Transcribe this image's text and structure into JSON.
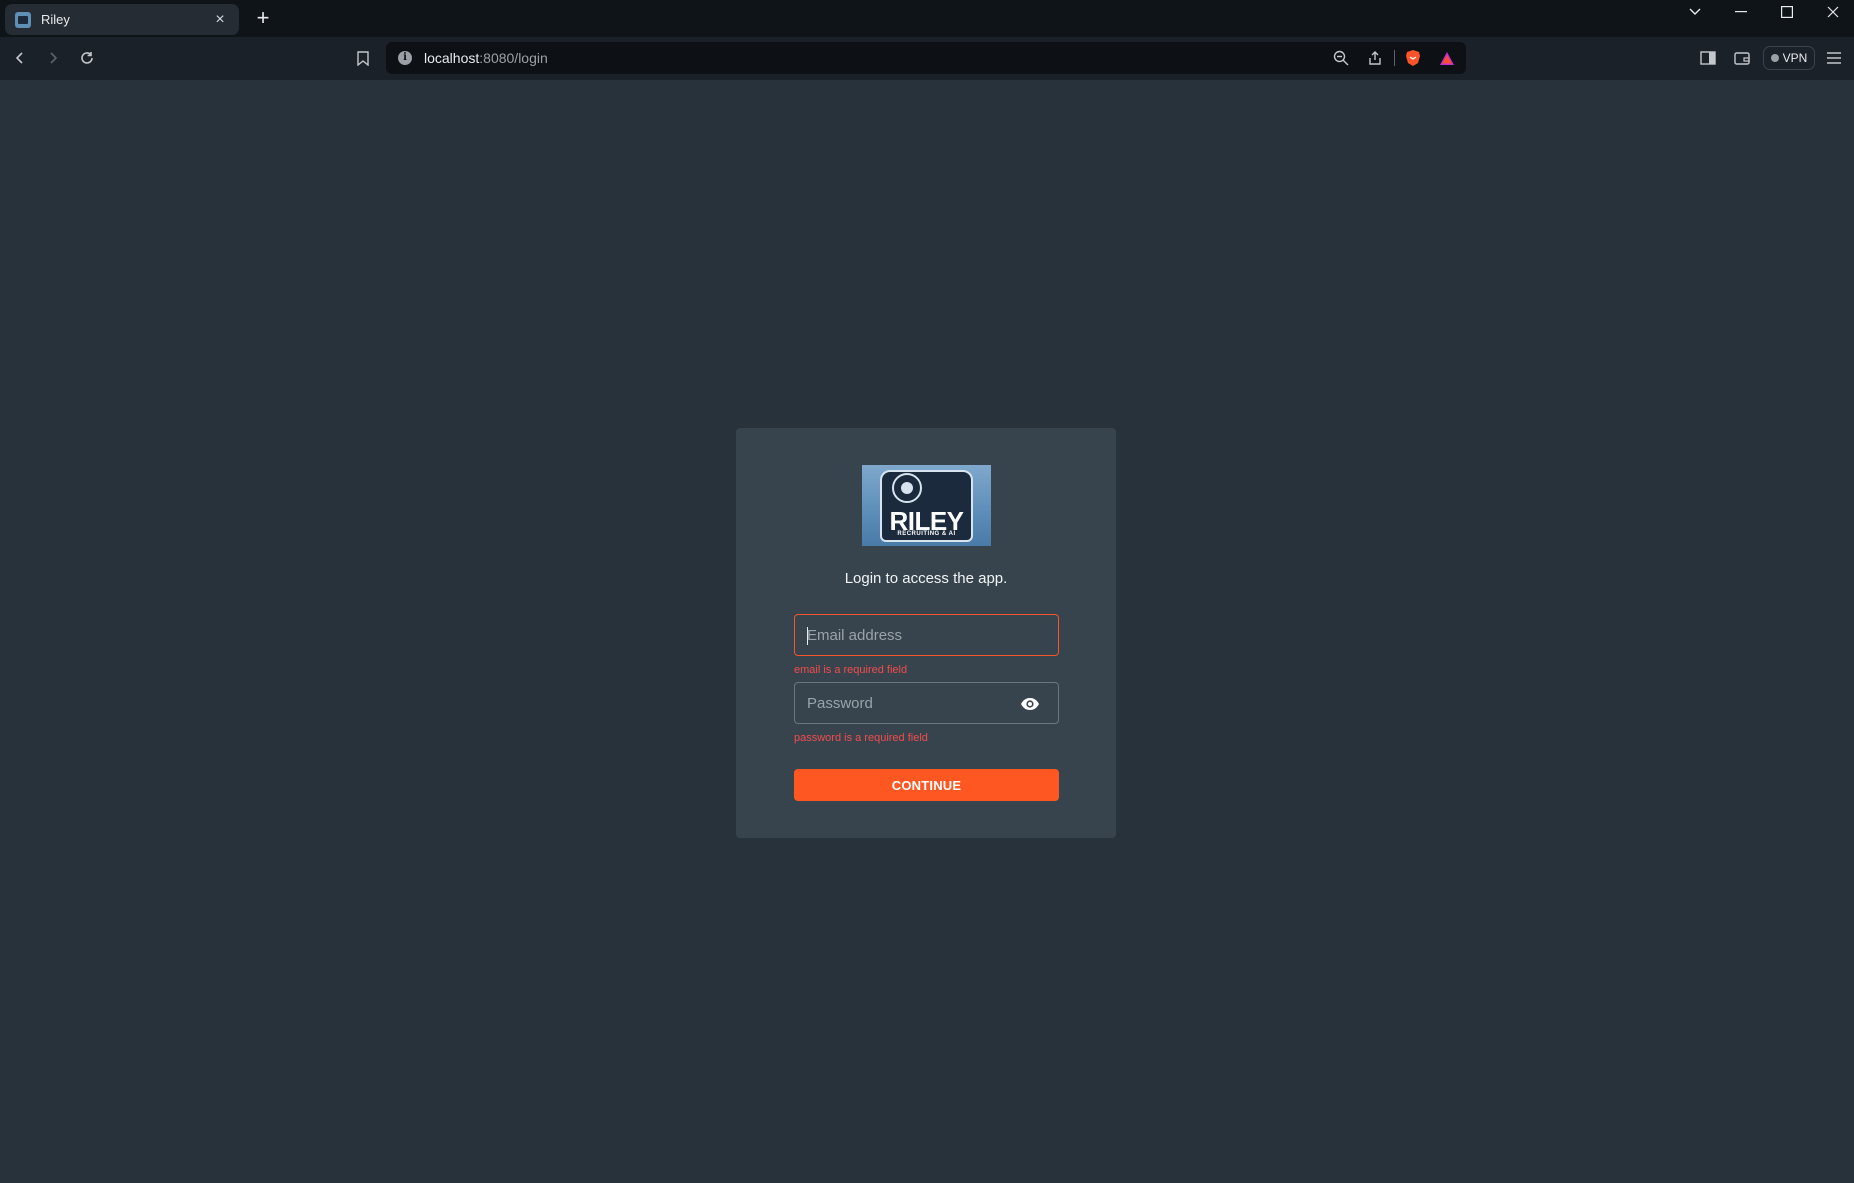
{
  "browser": {
    "tab": {
      "title": "Riley",
      "close_glyph": "×"
    },
    "new_tab_glyph": "+",
    "url": {
      "host": "localhost",
      "path": ":8080/login"
    },
    "vpn_label": "VPN",
    "icons": {
      "back": "back-arrow-icon",
      "forward": "forward-arrow-icon",
      "reload": "reload-icon",
      "bookmark": "bookmark-icon",
      "zoom": "zoom-out-icon",
      "share": "share-icon",
      "brave": "brave-shield-icon",
      "rewards": "brave-rewards-icon",
      "sidebar": "sidebar-icon",
      "wallet": "wallet-icon",
      "menu": "hamburger-menu-icon"
    }
  },
  "login": {
    "logo_text": "RILEY",
    "logo_subtext": "RECRUITING & AI",
    "heading": "Login to access the app.",
    "email": {
      "placeholder": "Email address",
      "value": "",
      "error": "email is a required field"
    },
    "password": {
      "placeholder": "Password",
      "value": "",
      "error": "password is a required field"
    },
    "submit_label": "CONTINUE"
  },
  "colors": {
    "page_bg": "#27323a",
    "card_bg": "#37444d",
    "accent": "#ff5722",
    "error": "#f24c4c"
  }
}
